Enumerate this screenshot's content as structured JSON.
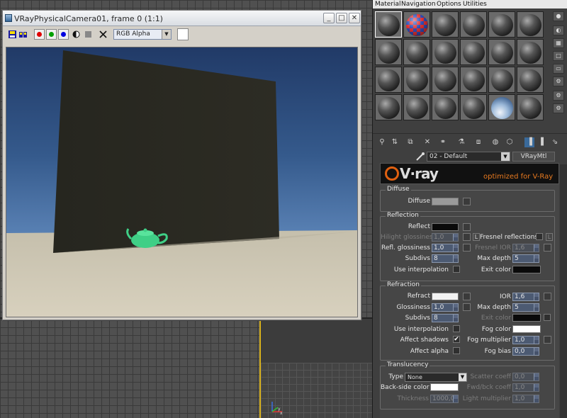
{
  "vfb": {
    "title": "VRayPhysicalCamera01, frame 0 (1:1)",
    "channel": "RGB Alpha",
    "window_buttons": {
      "minimize": "_",
      "maximize": "□",
      "close": "✕"
    }
  },
  "viewport": {
    "axis_labels": {
      "x": "x",
      "y": "y"
    }
  },
  "menu": [
    "Material",
    "Navigation",
    "Options",
    "Utilities"
  ],
  "material": {
    "name": "02 - Default",
    "type": "VRayMtl",
    "banner_tag": "optimized for V-Ray",
    "banner_logo": "V·ray"
  },
  "diffuse": {
    "group": "Diffuse",
    "label": "Diffuse",
    "color": "#9a9a9a"
  },
  "reflection": {
    "group": "Reflection",
    "reflect_label": "Reflect",
    "reflect_color": "#0a0a0a",
    "hilight_label": "Hilight glossiness",
    "hilight_value": "1,0",
    "refl_gloss_label": "Refl. glossiness",
    "refl_gloss_value": "1,0",
    "subdivs_label": "Subdivs",
    "subdivs_value": "8",
    "interp_label": "Use interpolation",
    "fresnel_label": "Fresnel reflections",
    "fresnel_ior_label": "Fresnel IOR",
    "fresnel_ior_value": "1,6",
    "maxdepth_label": "Max depth",
    "maxdepth_value": "5",
    "exit_label": "Exit color",
    "exit_color": "#0a0a0a",
    "lock": "L"
  },
  "refraction": {
    "group": "Refraction",
    "refract_label": "Refract",
    "refract_color": "#f2f2f2",
    "gloss_label": "Glossiness",
    "gloss_value": "1,0",
    "subdivs_label": "Subdivs",
    "subdivs_value": "8",
    "interp_label": "Use interpolation",
    "affect_shadows_label": "Affect shadows",
    "affect_shadows_check": "✔",
    "affect_alpha_label": "Affect alpha",
    "ior_label": "IOR",
    "ior_value": "1,6",
    "maxdepth_label": "Max depth",
    "maxdepth_value": "5",
    "exit_label": "Exit color",
    "exit_color": "#0a0a0a",
    "fog_color_label": "Fog color",
    "fog_color": "#ffffff",
    "fog_mult_label": "Fog multiplier",
    "fog_mult_value": "1,0",
    "fog_bias_label": "Fog bias",
    "fog_bias_value": "0,0"
  },
  "translucency": {
    "group": "Translucency",
    "type_label": "Type",
    "type_value": "None",
    "backside_label": "Back-side color",
    "backside_color": "#ffffff",
    "thickness_label": "Thickness",
    "thickness_value": "1000,0",
    "scatter_label": "Scatter coeff",
    "scatter_value": "0,0",
    "fwdbck_label": "Fwd/bck coeff",
    "fwdbck_value": "1,0",
    "light_mult_label": "Light multiplier",
    "light_mult_value": "1,0"
  }
}
